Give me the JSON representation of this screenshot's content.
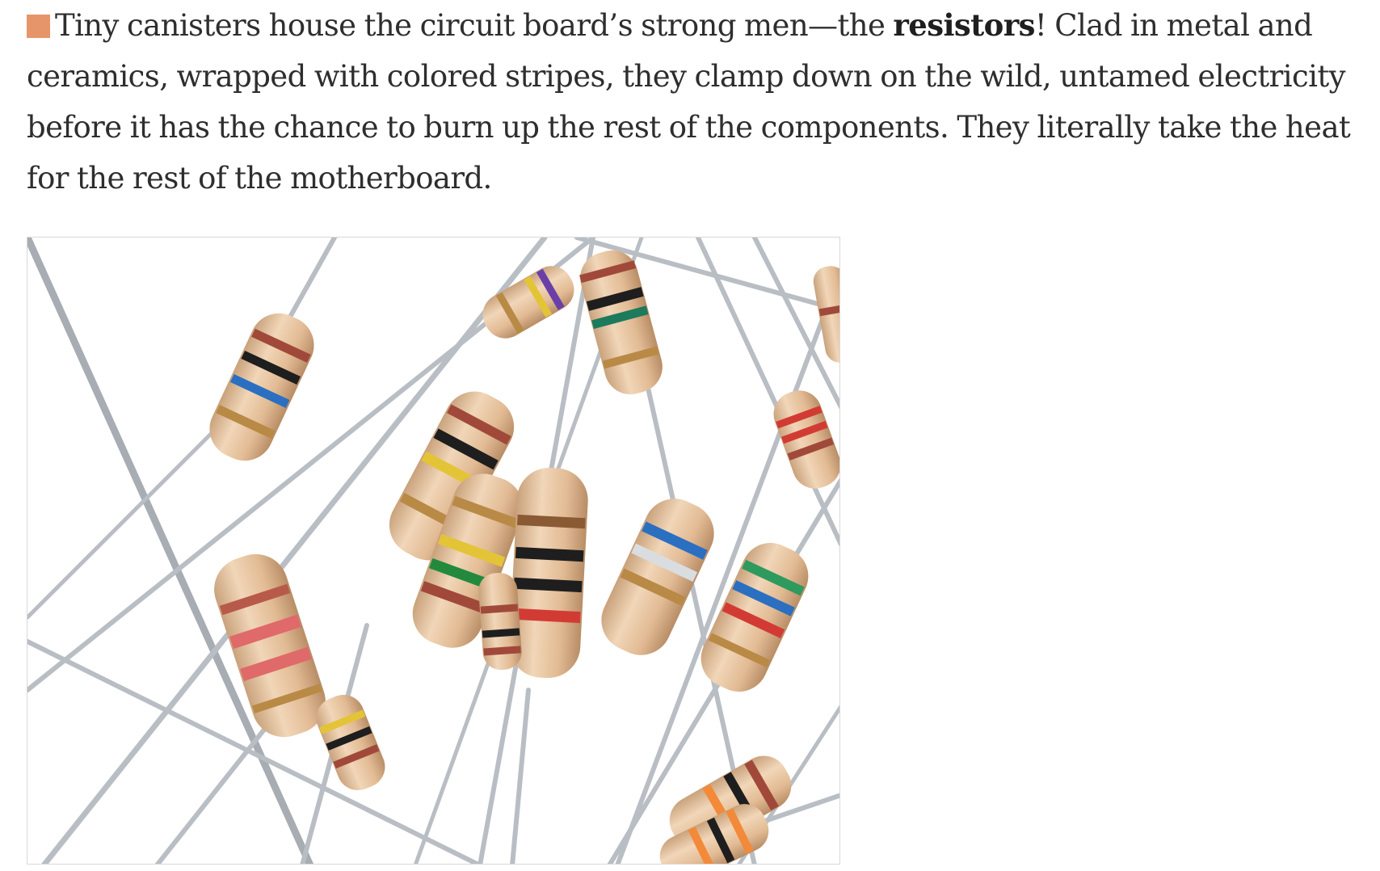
{
  "paragraph": {
    "intro": "Tiny canisters house the circuit board’s strong men—the ",
    "bold_term": "resistors",
    "rest": "! Clad in metal and ceramics, wrapped with colored stripes, they clamp down on the wild, untamed electricity before it has the chance to burn up the rest of the components. They literally take the heat for the rest of the motherboard."
  },
  "colors": {
    "bullet": "#e6956a",
    "resistor_body": "#e6c3a0",
    "lead_wire": "#b9bec4"
  },
  "icons": {
    "bullet": "square-bullet-icon"
  }
}
